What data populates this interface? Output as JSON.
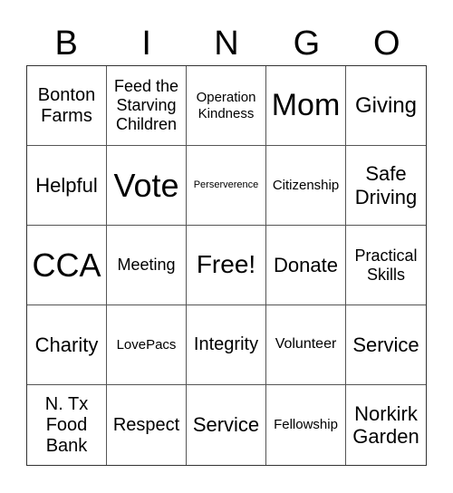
{
  "header": [
    "B",
    "I",
    "N",
    "G",
    "O"
  ],
  "cells": [
    {
      "text": "Bonton Farms",
      "size": "s20"
    },
    {
      "text": "Feed the Starving Children",
      "size": "s18"
    },
    {
      "text": "Operation Kindness",
      "size": "s15"
    },
    {
      "text": "Mom",
      "size": "s34"
    },
    {
      "text": "Giving",
      "size": "s24"
    },
    {
      "text": "Helpful",
      "size": "s22"
    },
    {
      "text": "Vote",
      "size": "s36"
    },
    {
      "text": "Perserverence",
      "size": "s11"
    },
    {
      "text": "Citizenship",
      "size": "s15"
    },
    {
      "text": "Safe Driving",
      "size": "s22"
    },
    {
      "text": "CCA",
      "size": "s36"
    },
    {
      "text": "Meeting",
      "size": "s18"
    },
    {
      "text": "Free!",
      "size": "s28"
    },
    {
      "text": "Donate",
      "size": "s22"
    },
    {
      "text": "Practical Skills",
      "size": "s18"
    },
    {
      "text": "Charity",
      "size": "s22"
    },
    {
      "text": "LovePacs",
      "size": "s15"
    },
    {
      "text": "Integrity",
      "size": "s20"
    },
    {
      "text": "Volunteer",
      "size": "s16"
    },
    {
      "text": "Service",
      "size": "s22"
    },
    {
      "text": "N. Tx Food Bank",
      "size": "s20"
    },
    {
      "text": "Respect",
      "size": "s20"
    },
    {
      "text": "Service",
      "size": "s22"
    },
    {
      "text": "Fellowship",
      "size": "s15"
    },
    {
      "text": "Norkirk Garden",
      "size": "s22"
    }
  ]
}
